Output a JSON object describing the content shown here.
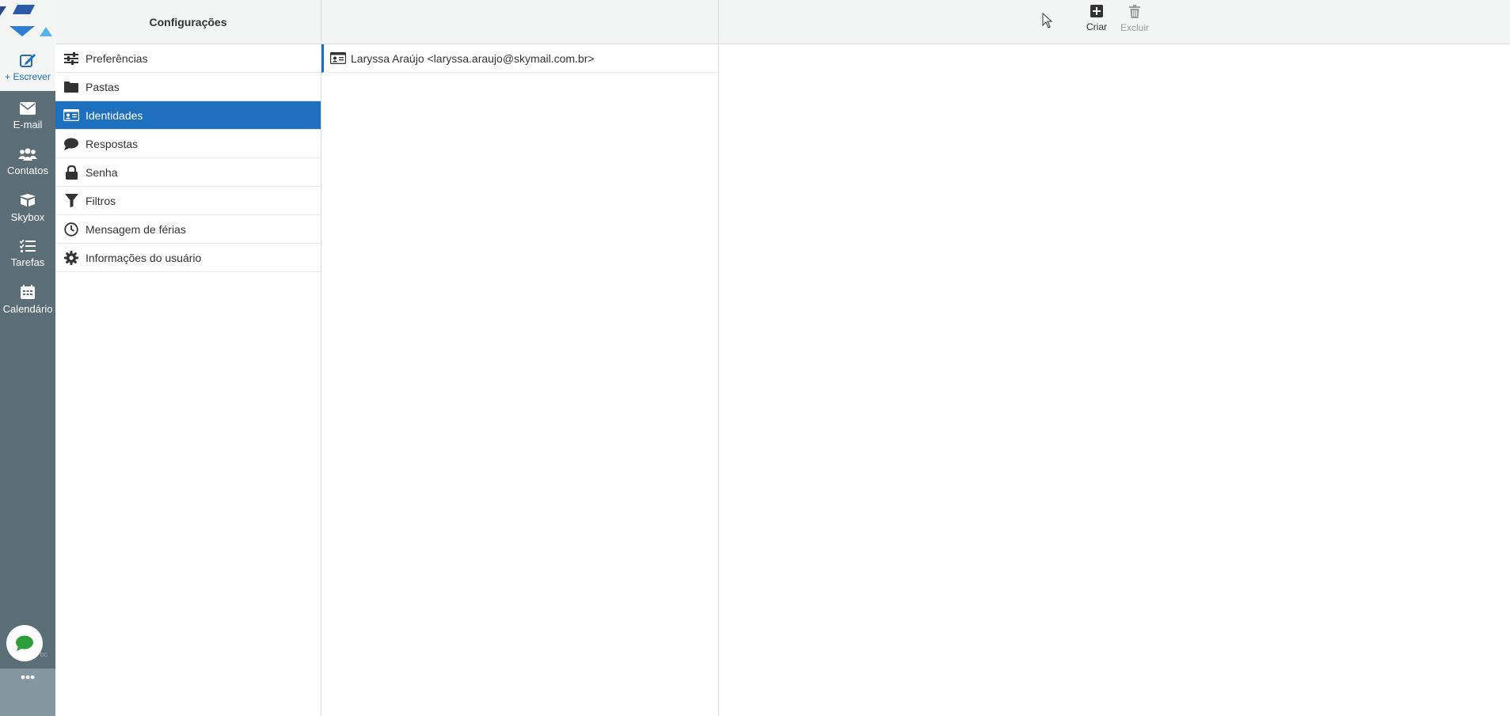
{
  "rail": {
    "compose_label": "+ Escrever",
    "items": [
      {
        "label": "E-mail",
        "icon": "envelope-icon"
      },
      {
        "label": "Contatos",
        "icon": "users-icon"
      },
      {
        "label": "Skybox",
        "icon": "box-icon"
      },
      {
        "label": "Tarefas",
        "icon": "tasks-icon"
      },
      {
        "label": "Calendário",
        "icon": "calendar-icon"
      }
    ],
    "chat_sub": "bc"
  },
  "settings": {
    "title": "Configurações",
    "items": [
      {
        "label": "Preferências",
        "icon": "sliders-icon"
      },
      {
        "label": "Pastas",
        "icon": "folder-icon"
      },
      {
        "label": "Identidades",
        "icon": "id-card-icon",
        "active": true
      },
      {
        "label": "Respostas",
        "icon": "speech-bubble-icon"
      },
      {
        "label": "Senha",
        "icon": "lock-icon"
      },
      {
        "label": "Filtros",
        "icon": "filter-icon"
      },
      {
        "label": "Mensagem de férias",
        "icon": "clock-icon"
      },
      {
        "label": "Informações do usuário",
        "icon": "gear-icon"
      }
    ]
  },
  "toolbar": {
    "create_label": "Criar",
    "delete_label": "Excluir"
  },
  "identities": [
    {
      "label": "Laryssa Araújo <laryssa.araujo@skymail.com.br>"
    }
  ],
  "colors": {
    "accent": "#1f6fbf",
    "rail": "#5b6e76",
    "header_bg": "#f3f4f4"
  }
}
